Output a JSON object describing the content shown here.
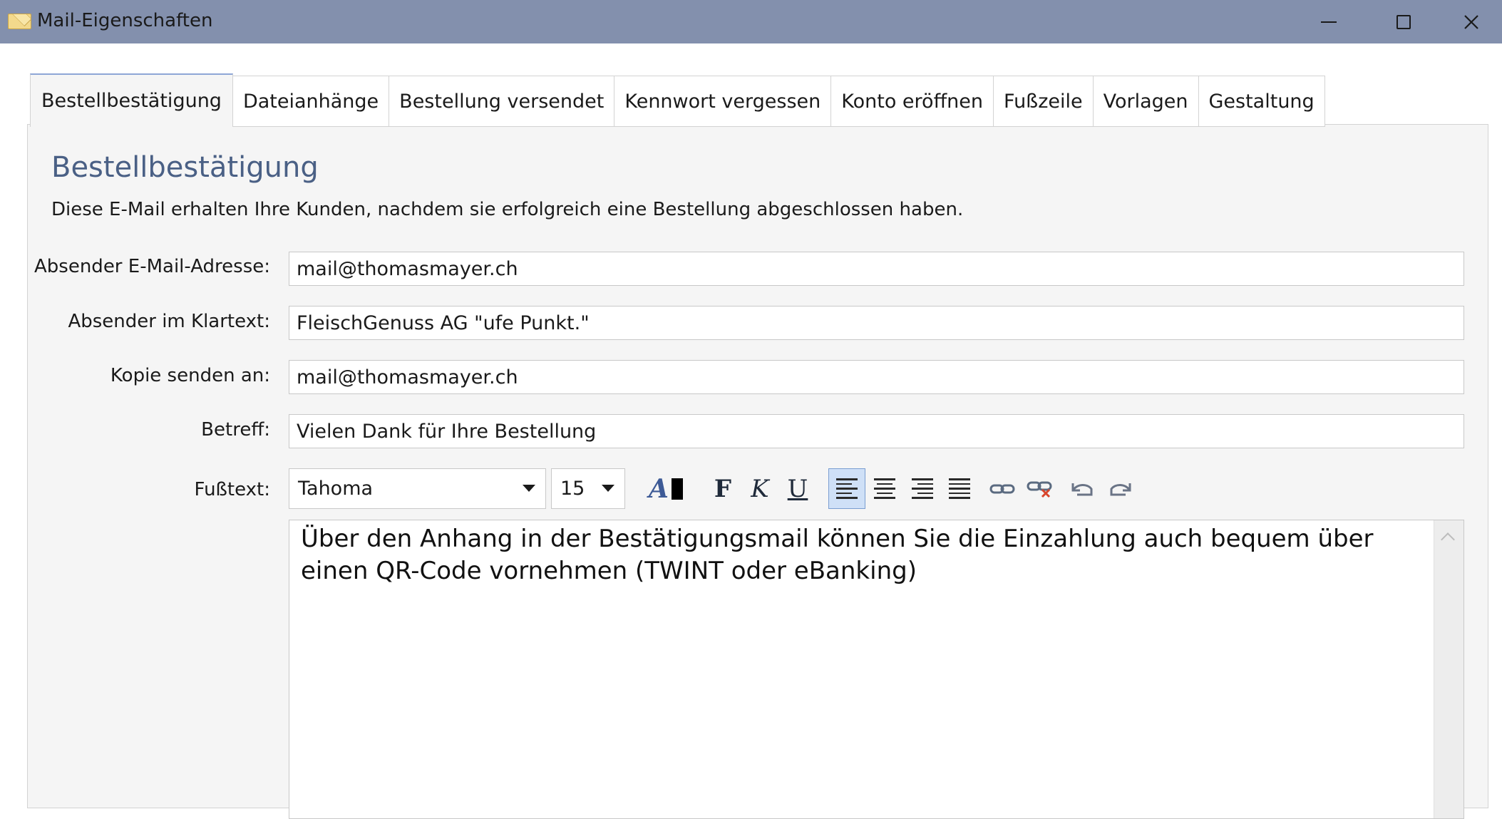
{
  "window": {
    "title": "Mail-Eigenschaften",
    "icon": "envelope-icon"
  },
  "tabs": [
    {
      "label": "Bestellbestätigung",
      "active": true
    },
    {
      "label": "Dateianhänge",
      "active": false
    },
    {
      "label": "Bestellung versendet",
      "active": false
    },
    {
      "label": "Kennwort vergessen",
      "active": false
    },
    {
      "label": "Konto eröffnen",
      "active": false
    },
    {
      "label": "Fußzeile",
      "active": false
    },
    {
      "label": "Vorlagen",
      "active": false
    },
    {
      "label": "Gestaltung",
      "active": false
    }
  ],
  "section": {
    "heading": "Bestellbestätigung",
    "description": "Diese E-Mail erhalten Ihre Kunden, nachdem sie erfolgreich eine Bestellung abgeschlossen haben."
  },
  "form": {
    "sender_email": {
      "label": "Absender E-Mail-Adresse:",
      "value": "mail@thomasmayer.ch"
    },
    "sender_name": {
      "label": "Absender im Klartext:",
      "value": "FleischGenuss AG \"ufe Punkt.\""
    },
    "cc": {
      "label": "Kopie senden an:",
      "value": "mail@thomasmayer.ch"
    },
    "subject": {
      "label": "Betreff:",
      "value": "Vielen Dank für Ihre Bestellung"
    },
    "footer_text": {
      "label": "Fußtext:"
    }
  },
  "toolbar": {
    "font_family": "Tahoma",
    "font_size": "15",
    "bold_glyph": "F",
    "italic_glyph": "K",
    "underline_glyph": "U",
    "color_glyph": "A",
    "selected_align": "left"
  },
  "editor": {
    "content": "Über den Anhang in der Bestätigungsmail können Sie die Einzahlung auch bequem über einen QR-Code vornehmen (TWINT oder eBanking)"
  },
  "colors": {
    "titlebar": "#8390ad",
    "heading": "#4a6085",
    "active_tab_accent": "#8ea6d6",
    "selected_tool_bg": "#cfe0f7"
  }
}
